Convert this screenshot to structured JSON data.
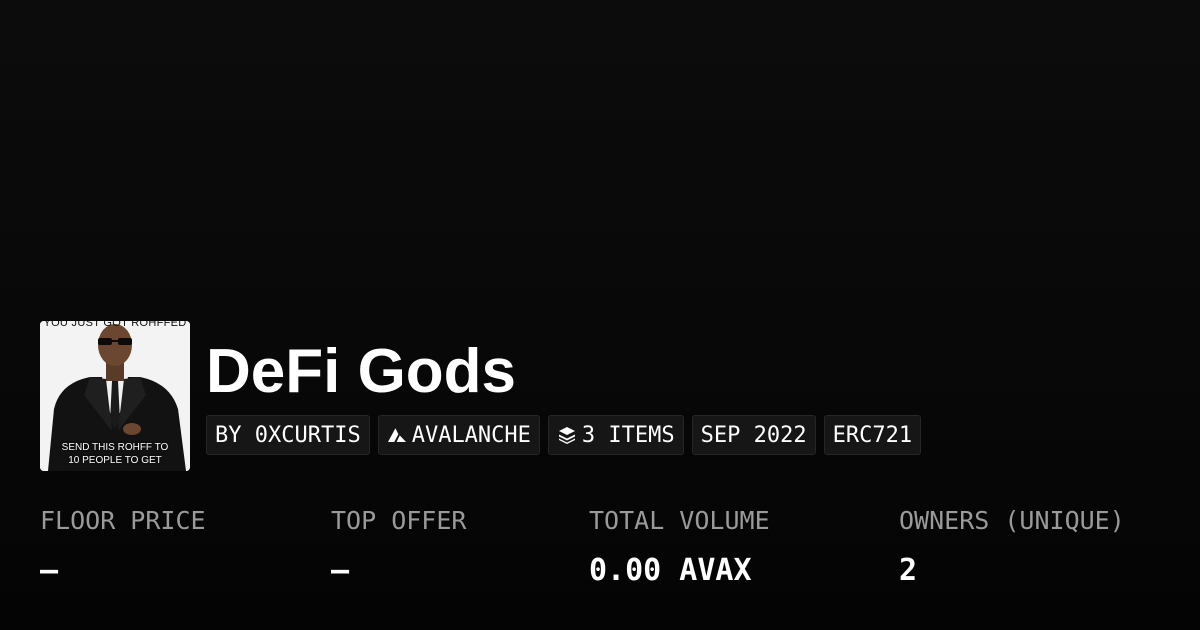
{
  "collection": {
    "title": "DeFi Gods",
    "thumbnail": {
      "top_text": "YOU JUST GOT ROHFFED",
      "caption_line1": "SEND THIS ROHFF TO",
      "caption_line2": "10 PEOPLE TO GET"
    }
  },
  "tags": {
    "creator": "BY 0XCURTIS",
    "chain": "AVALANCHE",
    "chain_icon": "avalanche-icon",
    "items": "3 ITEMS",
    "items_icon": "layers-icon",
    "date": "SEP 2022",
    "standard": "ERC721"
  },
  "stats": {
    "floor_price": {
      "label": "FLOOR PRICE",
      "value": "–"
    },
    "top_offer": {
      "label": "TOP OFFER",
      "value": "–"
    },
    "total_volume": {
      "label": "TOTAL VOLUME",
      "value": "0.00 AVAX"
    },
    "owners": {
      "label": "OWNERS (UNIQUE)",
      "value": "2"
    }
  },
  "colors": {
    "background": "#0a0a0a",
    "text": "#ffffff",
    "muted_label": "#9a9a9a",
    "tag_background": "#161616"
  }
}
